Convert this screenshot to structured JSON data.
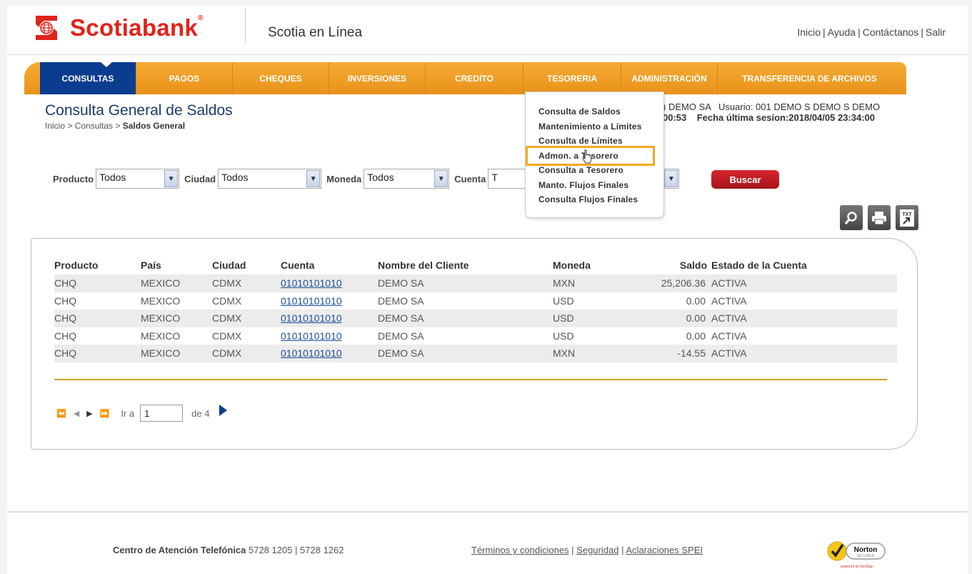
{
  "header": {
    "brand": "Scotiabank",
    "brand_mark": "®",
    "subtitle": "Scotia en Línea",
    "links": [
      "Inicio",
      "Ayuda",
      "Contáctanos",
      "Salir"
    ]
  },
  "nav": {
    "items": [
      "CONSULTAS",
      "PAGOS",
      "CHEQUES",
      "INVERSIONES",
      "CREDITO",
      "TESORERIA",
      "ADMINISTRACIÓN",
      "TRANSFERENCIA DE ARCHIVOS"
    ],
    "active": "CONSULTAS"
  },
  "tesoreria_menu": {
    "items": [
      "Consulta de Saldos",
      "Mantenimiento a Límites",
      "Consulta de Límites",
      "Admon. a Tesorero",
      "Consulta a Tesorero",
      "Manto. Flujos Finales",
      "Consulta Flujos Finales"
    ],
    "highlighted": "Admon. a Tesorero"
  },
  "page": {
    "title": "Consulta General de Saldos",
    "breadcrumb_prefix": "Inicio > Consultas > ",
    "breadcrumb_current": "Saldos General",
    "session_line1": ") DEMO SA   Usuario: 001 DEMO S DEMO S DEMO",
    "session_line2": "00:53    Fecha última sesion:2018/04/05 23:34:00"
  },
  "filters": {
    "producto_label": "Producto",
    "producto_value": "Todos",
    "ciudad_label": "Ciudad",
    "ciudad_value": "Todos",
    "moneda_label": "Moneda",
    "moneda_value": "Todos",
    "cuenta_label": "Cuenta",
    "cuenta_value": "T",
    "search_button": "Buscar"
  },
  "toolbar": {
    "icons": [
      "search-icon",
      "print-icon",
      "txt-export-icon"
    ],
    "txt_label": "TXT"
  },
  "table": {
    "headers": [
      "Producto",
      "País",
      "Ciudad",
      "Cuenta",
      "Nombre del Cliente",
      "Moneda",
      "Saldo",
      "Estado de la Cuenta"
    ],
    "rows": [
      [
        "CHQ",
        "MEXICO",
        "CDMX",
        "01010101010",
        "DEMO SA",
        "MXN",
        "25,206.36",
        "ACTIVA"
      ],
      [
        "CHQ",
        "MEXICO",
        "CDMX",
        "01010101010",
        "DEMO SA",
        "USD",
        "0.00",
        "ACTIVA"
      ],
      [
        "CHQ",
        "MEXICO",
        "CDMX",
        "01010101010",
        "DEMO SA",
        "USD",
        "0.00",
        "ACTIVA"
      ],
      [
        "CHQ",
        "MEXICO",
        "CDMX",
        "01010101010",
        "DEMO SA",
        "USD",
        "0.00",
        "ACTIVA"
      ],
      [
        "CHQ",
        "MEXICO",
        "CDMX",
        "01010101010",
        "DEMO SA",
        "MXN",
        "-14.55",
        "ACTIVA"
      ]
    ]
  },
  "pager": {
    "goto_label": "Ir a",
    "page_value": "1",
    "of_label": "de 4"
  },
  "footer": {
    "contact_label": "Centro de Atención Telefónica",
    "contact_numbers": "5728 1205 | 5728 1262",
    "links": [
      "Términos y condiciones",
      "Seguridad",
      "Aclaraciones SPEI"
    ],
    "badge_title": "Norton",
    "badge_sub": "SECURED",
    "badge_powered": "powered by VeriSign"
  },
  "colors": {
    "brand_red": "#e2231a",
    "nav_orange": "#f0a125",
    "nav_active": "#0a3d8f",
    "highlight": "#f5a921"
  }
}
